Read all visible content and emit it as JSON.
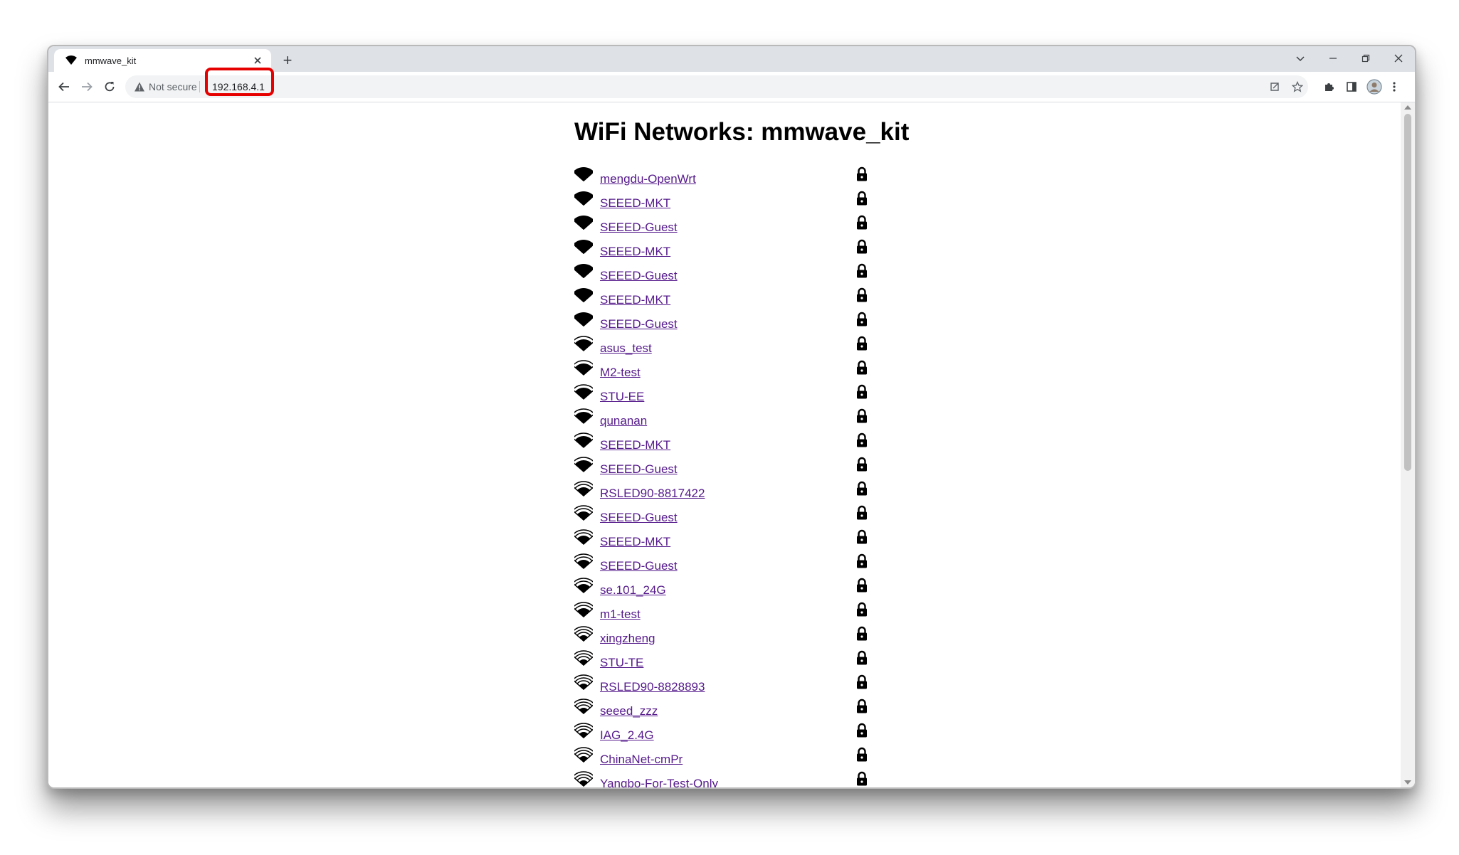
{
  "browser": {
    "tab_title": "mmwave_kit",
    "new_tab_label": "+",
    "security_label": "Not secure",
    "url": "192.168.4.1"
  },
  "page": {
    "title": "WiFi Networks: mmwave_kit"
  },
  "networks": [
    {
      "ssid": "mengdu-OpenWrt",
      "signal": 5,
      "secured": true
    },
    {
      "ssid": "SEEED-MKT",
      "signal": 5,
      "secured": true
    },
    {
      "ssid": "SEEED-Guest",
      "signal": 5,
      "secured": true
    },
    {
      "ssid": "SEEED-MKT",
      "signal": 5,
      "secured": true
    },
    {
      "ssid": "SEEED-Guest",
      "signal": 5,
      "secured": true
    },
    {
      "ssid": "SEEED-MKT",
      "signal": 5,
      "secured": true
    },
    {
      "ssid": "SEEED-Guest",
      "signal": 5,
      "secured": true
    },
    {
      "ssid": "asus_test",
      "signal": 4,
      "secured": true
    },
    {
      "ssid": "M2-test",
      "signal": 4,
      "secured": true
    },
    {
      "ssid": "STU-EE",
      "signal": 4,
      "secured": true
    },
    {
      "ssid": "qunanan",
      "signal": 4,
      "secured": true
    },
    {
      "ssid": "SEEED-MKT",
      "signal": 4,
      "secured": true
    },
    {
      "ssid": "SEEED-Guest",
      "signal": 4,
      "secured": true
    },
    {
      "ssid": "RSLED90-8817422",
      "signal": 3,
      "secured": true
    },
    {
      "ssid": "SEEED-Guest",
      "signal": 3,
      "secured": true
    },
    {
      "ssid": "SEEED-MKT",
      "signal": 3,
      "secured": true
    },
    {
      "ssid": "SEEED-Guest",
      "signal": 3,
      "secured": true
    },
    {
      "ssid": "se.101_24G",
      "signal": 3,
      "secured": true
    },
    {
      "ssid": "m1-test",
      "signal": 3,
      "secured": true
    },
    {
      "ssid": "xingzheng",
      "signal": 2,
      "secured": true
    },
    {
      "ssid": "STU-TE",
      "signal": 2,
      "secured": true
    },
    {
      "ssid": "RSLED90-8828893",
      "signal": 2,
      "secured": true
    },
    {
      "ssid": "seeed_zzz",
      "signal": 2,
      "secured": true
    },
    {
      "ssid": "IAG_2.4G",
      "signal": 2,
      "secured": true
    },
    {
      "ssid": "ChinaNet-cmPr",
      "signal": 2,
      "secured": true
    },
    {
      "ssid": "Yangbo-For-Test-Only",
      "signal": 2,
      "secured": true
    }
  ],
  "colors": {
    "link_visited": "#551a8b",
    "highlight_box": "#e60000",
    "tab_strip": "#dee1e6",
    "omnibox": "#f1f3f4"
  }
}
